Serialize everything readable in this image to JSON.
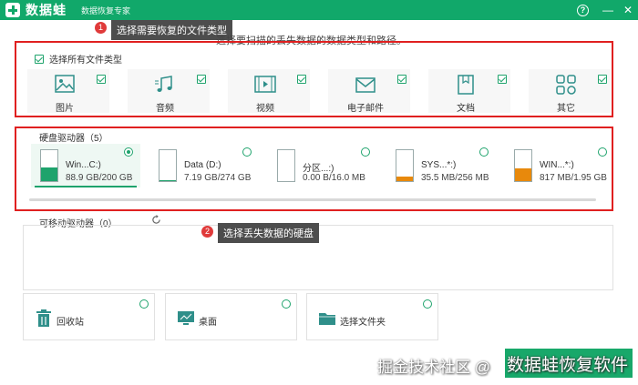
{
  "app": {
    "name": "数据蛙",
    "subtitle": "数据恢复专家"
  },
  "window": {
    "help": "?",
    "minimize": "—",
    "close": "✕"
  },
  "callouts": [
    {
      "num": "1",
      "text": "选择需要恢复的文件类型"
    },
    {
      "num": "2",
      "text": "选择丢失数据的硬盘"
    }
  ],
  "header_text": "选择要扫描的丢失数据的数据类型和路径。",
  "file_types": {
    "select_all_label": "选择所有文件类型",
    "items": [
      {
        "label": "图片",
        "icon": "image-icon"
      },
      {
        "label": "音频",
        "icon": "music-icon"
      },
      {
        "label": "视频",
        "icon": "video-icon"
      },
      {
        "label": "电子邮件",
        "icon": "email-icon"
      },
      {
        "label": "文档",
        "icon": "document-icon"
      },
      {
        "label": "其它",
        "icon": "apps-icon"
      }
    ]
  },
  "hard_drives": {
    "title": "硬盘驱动器（5）",
    "items": [
      {
        "name": "Win...C:)",
        "size": "88.9 GB/200 GB",
        "fill": 0.44,
        "fill_color": "#1ea36c",
        "selected": true
      },
      {
        "name": "Data (D:)",
        "size": "7.19 GB/274 GB",
        "fill": 0.03,
        "fill_color": "#1ea36c",
        "selected": false
      },
      {
        "name": "分区...:)",
        "size": "0.00  B/16.0 MB",
        "fill": 0.0,
        "fill_color": "#1ea36c",
        "selected": false
      },
      {
        "name": "SYS...*:)",
        "size": "35.5 MB/256 MB",
        "fill": 0.14,
        "fill_color": "#e8890c",
        "selected": false
      },
      {
        "name": "WIN...*:)",
        "size": "817 MB/1.95 GB",
        "fill": 0.42,
        "fill_color": "#e8890c",
        "selected": false
      }
    ]
  },
  "removable": {
    "title": "可移动驱动器（0）"
  },
  "locations": [
    {
      "label": "回收站",
      "icon": "recycle-bin-icon"
    },
    {
      "label": "桌面",
      "icon": "desktop-icon"
    },
    {
      "label": "选择文件夹",
      "icon": "folder-icon"
    }
  ],
  "watermarks": {
    "community": "掘金技术社区 @",
    "brand": "数据蛙恢复软件"
  },
  "colors": {
    "brand": "#11a86a",
    "accent": "#1ea36c",
    "warn": "#e8890c",
    "highlight": "#e02020"
  }
}
